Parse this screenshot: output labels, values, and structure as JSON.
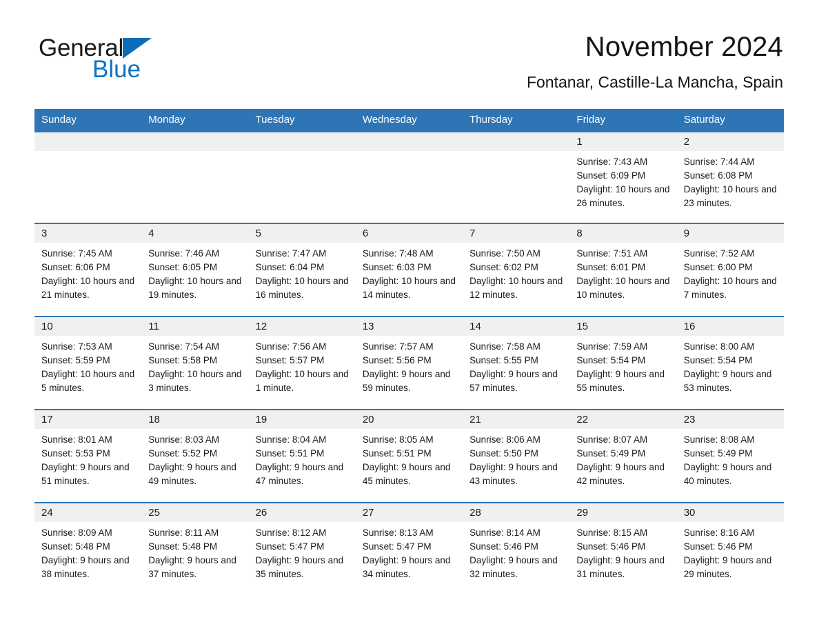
{
  "brand": {
    "name_part1": "General",
    "name_part2": "Blue",
    "accent_color": "#0b72c4",
    "triangle_color": "#0b6cb8"
  },
  "header": {
    "title": "November 2024",
    "location": "Fontanar, Castille-La Mancha, Spain"
  },
  "theme": {
    "header_bar_color": "#2e75b6",
    "daynum_strip_color": "#f0f0f0",
    "text_color": "#1a1a1a"
  },
  "weekday_headers": [
    "Sunday",
    "Monday",
    "Tuesday",
    "Wednesday",
    "Thursday",
    "Friday",
    "Saturday"
  ],
  "weeks": [
    [
      {
        "day": "",
        "sunrise": "",
        "sunset": "",
        "daylight": ""
      },
      {
        "day": "",
        "sunrise": "",
        "sunset": "",
        "daylight": ""
      },
      {
        "day": "",
        "sunrise": "",
        "sunset": "",
        "daylight": ""
      },
      {
        "day": "",
        "sunrise": "",
        "sunset": "",
        "daylight": ""
      },
      {
        "day": "",
        "sunrise": "",
        "sunset": "",
        "daylight": ""
      },
      {
        "day": "1",
        "sunrise": "Sunrise: 7:43 AM",
        "sunset": "Sunset: 6:09 PM",
        "daylight": "Daylight: 10 hours and 26 minutes."
      },
      {
        "day": "2",
        "sunrise": "Sunrise: 7:44 AM",
        "sunset": "Sunset: 6:08 PM",
        "daylight": "Daylight: 10 hours and 23 minutes."
      }
    ],
    [
      {
        "day": "3",
        "sunrise": "Sunrise: 7:45 AM",
        "sunset": "Sunset: 6:06 PM",
        "daylight": "Daylight: 10 hours and 21 minutes."
      },
      {
        "day": "4",
        "sunrise": "Sunrise: 7:46 AM",
        "sunset": "Sunset: 6:05 PM",
        "daylight": "Daylight: 10 hours and 19 minutes."
      },
      {
        "day": "5",
        "sunrise": "Sunrise: 7:47 AM",
        "sunset": "Sunset: 6:04 PM",
        "daylight": "Daylight: 10 hours and 16 minutes."
      },
      {
        "day": "6",
        "sunrise": "Sunrise: 7:48 AM",
        "sunset": "Sunset: 6:03 PM",
        "daylight": "Daylight: 10 hours and 14 minutes."
      },
      {
        "day": "7",
        "sunrise": "Sunrise: 7:50 AM",
        "sunset": "Sunset: 6:02 PM",
        "daylight": "Daylight: 10 hours and 12 minutes."
      },
      {
        "day": "8",
        "sunrise": "Sunrise: 7:51 AM",
        "sunset": "Sunset: 6:01 PM",
        "daylight": "Daylight: 10 hours and 10 minutes."
      },
      {
        "day": "9",
        "sunrise": "Sunrise: 7:52 AM",
        "sunset": "Sunset: 6:00 PM",
        "daylight": "Daylight: 10 hours and 7 minutes."
      }
    ],
    [
      {
        "day": "10",
        "sunrise": "Sunrise: 7:53 AM",
        "sunset": "Sunset: 5:59 PM",
        "daylight": "Daylight: 10 hours and 5 minutes."
      },
      {
        "day": "11",
        "sunrise": "Sunrise: 7:54 AM",
        "sunset": "Sunset: 5:58 PM",
        "daylight": "Daylight: 10 hours and 3 minutes."
      },
      {
        "day": "12",
        "sunrise": "Sunrise: 7:56 AM",
        "sunset": "Sunset: 5:57 PM",
        "daylight": "Daylight: 10 hours and 1 minute."
      },
      {
        "day": "13",
        "sunrise": "Sunrise: 7:57 AM",
        "sunset": "Sunset: 5:56 PM",
        "daylight": "Daylight: 9 hours and 59 minutes."
      },
      {
        "day": "14",
        "sunrise": "Sunrise: 7:58 AM",
        "sunset": "Sunset: 5:55 PM",
        "daylight": "Daylight: 9 hours and 57 minutes."
      },
      {
        "day": "15",
        "sunrise": "Sunrise: 7:59 AM",
        "sunset": "Sunset: 5:54 PM",
        "daylight": "Daylight: 9 hours and 55 minutes."
      },
      {
        "day": "16",
        "sunrise": "Sunrise: 8:00 AM",
        "sunset": "Sunset: 5:54 PM",
        "daylight": "Daylight: 9 hours and 53 minutes."
      }
    ],
    [
      {
        "day": "17",
        "sunrise": "Sunrise: 8:01 AM",
        "sunset": "Sunset: 5:53 PM",
        "daylight": "Daylight: 9 hours and 51 minutes."
      },
      {
        "day": "18",
        "sunrise": "Sunrise: 8:03 AM",
        "sunset": "Sunset: 5:52 PM",
        "daylight": "Daylight: 9 hours and 49 minutes."
      },
      {
        "day": "19",
        "sunrise": "Sunrise: 8:04 AM",
        "sunset": "Sunset: 5:51 PM",
        "daylight": "Daylight: 9 hours and 47 minutes."
      },
      {
        "day": "20",
        "sunrise": "Sunrise: 8:05 AM",
        "sunset": "Sunset: 5:51 PM",
        "daylight": "Daylight: 9 hours and 45 minutes."
      },
      {
        "day": "21",
        "sunrise": "Sunrise: 8:06 AM",
        "sunset": "Sunset: 5:50 PM",
        "daylight": "Daylight: 9 hours and 43 minutes."
      },
      {
        "day": "22",
        "sunrise": "Sunrise: 8:07 AM",
        "sunset": "Sunset: 5:49 PM",
        "daylight": "Daylight: 9 hours and 42 minutes."
      },
      {
        "day": "23",
        "sunrise": "Sunrise: 8:08 AM",
        "sunset": "Sunset: 5:49 PM",
        "daylight": "Daylight: 9 hours and 40 minutes."
      }
    ],
    [
      {
        "day": "24",
        "sunrise": "Sunrise: 8:09 AM",
        "sunset": "Sunset: 5:48 PM",
        "daylight": "Daylight: 9 hours and 38 minutes."
      },
      {
        "day": "25",
        "sunrise": "Sunrise: 8:11 AM",
        "sunset": "Sunset: 5:48 PM",
        "daylight": "Daylight: 9 hours and 37 minutes."
      },
      {
        "day": "26",
        "sunrise": "Sunrise: 8:12 AM",
        "sunset": "Sunset: 5:47 PM",
        "daylight": "Daylight: 9 hours and 35 minutes."
      },
      {
        "day": "27",
        "sunrise": "Sunrise: 8:13 AM",
        "sunset": "Sunset: 5:47 PM",
        "daylight": "Daylight: 9 hours and 34 minutes."
      },
      {
        "day": "28",
        "sunrise": "Sunrise: 8:14 AM",
        "sunset": "Sunset: 5:46 PM",
        "daylight": "Daylight: 9 hours and 32 minutes."
      },
      {
        "day": "29",
        "sunrise": "Sunrise: 8:15 AM",
        "sunset": "Sunset: 5:46 PM",
        "daylight": "Daylight: 9 hours and 31 minutes."
      },
      {
        "day": "30",
        "sunrise": "Sunrise: 8:16 AM",
        "sunset": "Sunset: 5:46 PM",
        "daylight": "Daylight: 9 hours and 29 minutes."
      }
    ]
  ]
}
